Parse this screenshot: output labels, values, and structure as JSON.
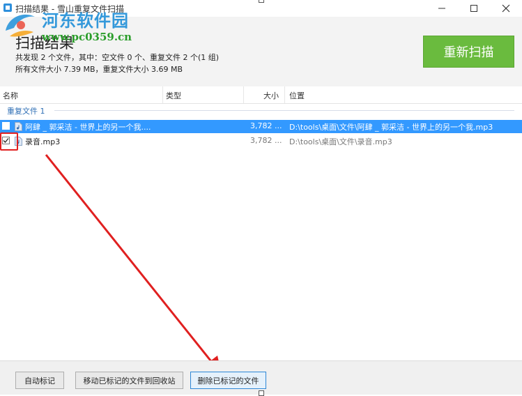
{
  "window": {
    "title": "扫描结果 - 雪山重复文件扫描"
  },
  "watermark": {
    "title": "河东软件园",
    "url": "www.pc0359.cn"
  },
  "header": {
    "title": "扫描结果",
    "summary_line1": "共发现 2 个文件，其中：空文件 0 个、重复文件 2 个(1 组)",
    "summary_line2": "所有文件大小 7.39 MB，重复文件大小 3.69 MB",
    "rescan_label": "重新扫描"
  },
  "columns": {
    "name": "名称",
    "type": "类型",
    "size": "大小",
    "path": "位置"
  },
  "group": {
    "label": "重复文件 1"
  },
  "rows": [
    {
      "name": "阿肆 _ 郭采洁 - 世界上的另一个我....",
      "size": "3,782 ...",
      "path": "D:\\tools\\桌面\\文件\\阿肆 _ 郭采洁 - 世界上的另一个我.mp3",
      "checked": false,
      "selected": true
    },
    {
      "name": "录音.mp3",
      "size": "3,782 ...",
      "path": "D:\\tools\\桌面\\文件\\录音.mp3",
      "checked": true,
      "selected": false
    }
  ],
  "footer": {
    "auto_mark_label": "自动标记",
    "move_recycle_label": "移动已标记的文件到回收站",
    "delete_marked_label": "删除已标记的文件"
  },
  "colors": {
    "accent_green": "#6abb3e",
    "selection_blue": "#3399ff",
    "annotation_red": "#e02020"
  },
  "icons": {
    "app": "scan-app-icon",
    "file": "audio-file-icon",
    "checkbox_checked": "check-icon"
  }
}
